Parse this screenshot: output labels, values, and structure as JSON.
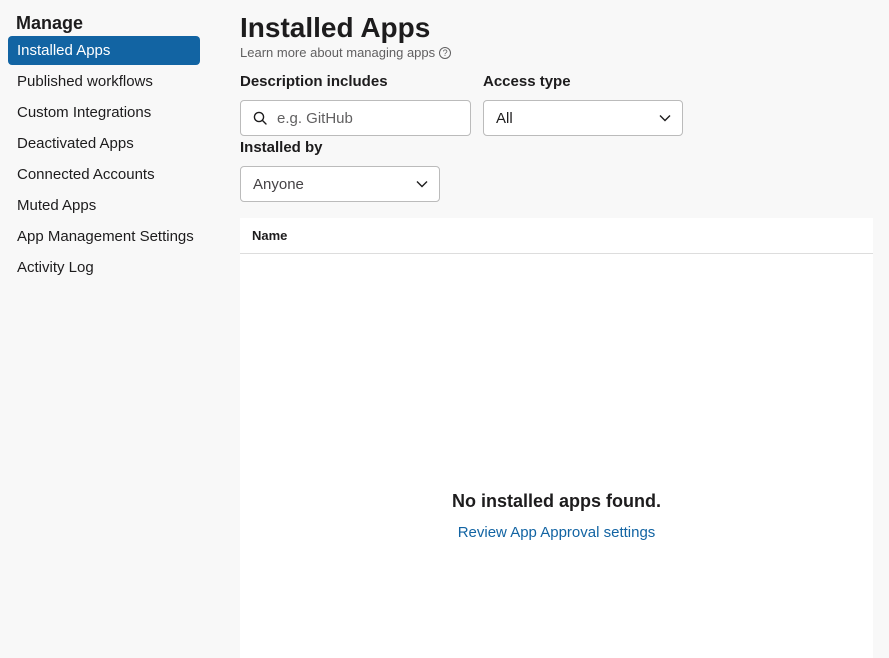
{
  "sidebar": {
    "title": "Manage",
    "items": [
      {
        "label": "Installed Apps",
        "active": true
      },
      {
        "label": "Published workflows"
      },
      {
        "label": "Custom Integrations"
      },
      {
        "label": "Deactivated Apps"
      },
      {
        "label": "Connected Accounts"
      },
      {
        "label": "Muted Apps"
      },
      {
        "label": "App Management Settings"
      },
      {
        "label": "Activity Log"
      }
    ]
  },
  "main": {
    "title": "Installed Apps",
    "learn_more": "Learn more about managing apps",
    "help_icon": "?"
  },
  "filters": {
    "description": {
      "label": "Description includes",
      "placeholder": "e.g. GitHub",
      "value": ""
    },
    "access_type": {
      "label": "Access type",
      "value": "All"
    },
    "installed_by": {
      "label": "Installed by",
      "value": "Anyone"
    }
  },
  "table": {
    "columns": [
      "Name"
    ],
    "empty_title": "No installed apps found.",
    "empty_link": "Review App Approval settings"
  },
  "colors": {
    "accent": "#1264a3",
    "background": "#f8f8f8"
  }
}
